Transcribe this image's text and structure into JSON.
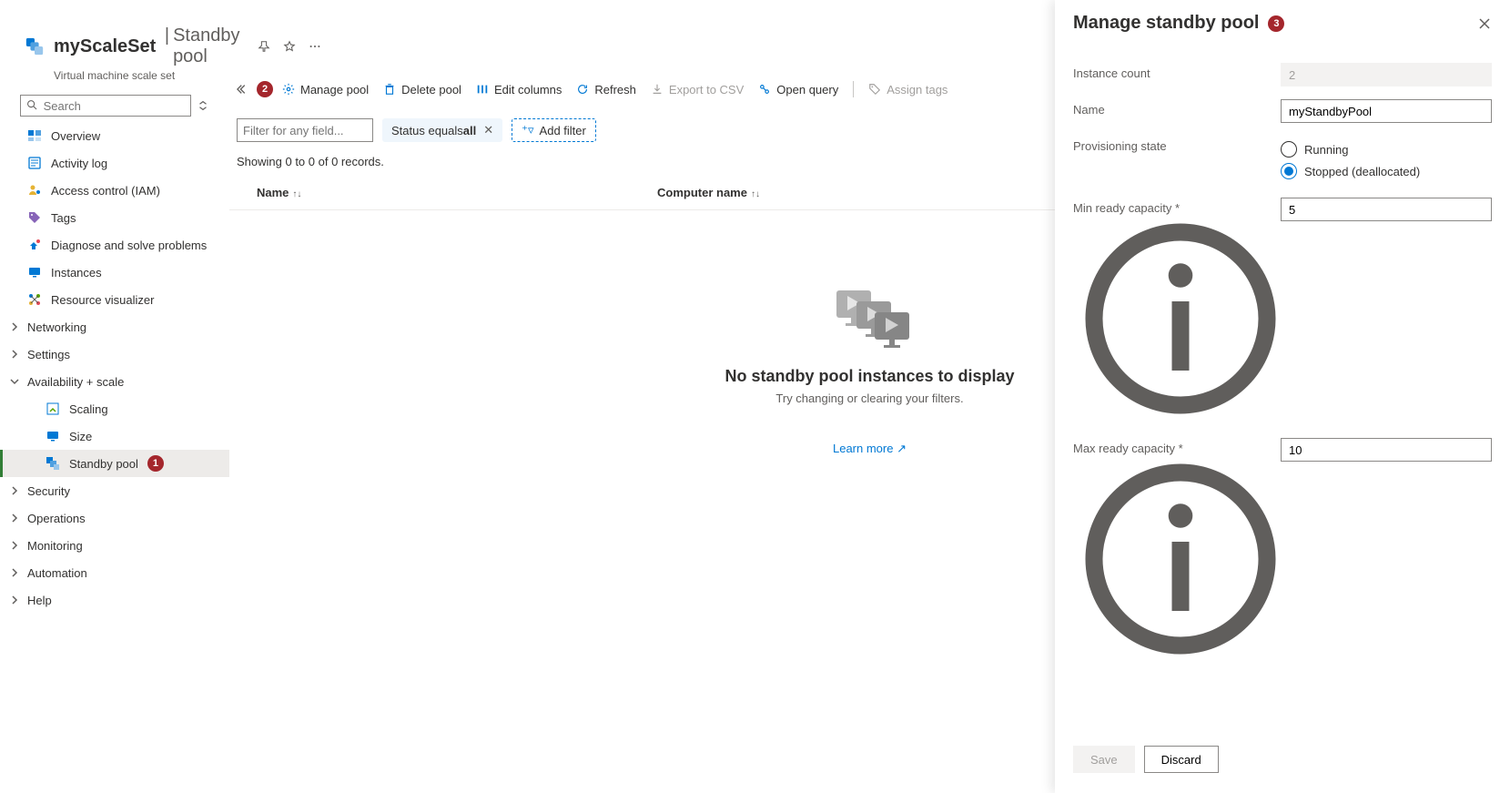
{
  "header": {
    "resourceName": "myScaleSet",
    "separator": "|",
    "pageTitle": "Standby pool",
    "resourceType": "Virtual machine scale set"
  },
  "search": {
    "placeholder": "Search"
  },
  "nav": {
    "items": [
      {
        "label": "Overview"
      },
      {
        "label": "Activity log"
      },
      {
        "label": "Access control (IAM)"
      },
      {
        "label": "Tags"
      },
      {
        "label": "Diagnose and solve problems"
      },
      {
        "label": "Instances"
      },
      {
        "label": "Resource visualizer"
      }
    ],
    "groups": [
      {
        "label": "Networking",
        "expanded": false
      },
      {
        "label": "Settings",
        "expanded": false
      },
      {
        "label": "Availability + scale",
        "expanded": true,
        "children": [
          {
            "label": "Scaling"
          },
          {
            "label": "Size"
          },
          {
            "label": "Standby pool",
            "selected": true
          }
        ]
      },
      {
        "label": "Security",
        "expanded": false
      },
      {
        "label": "Operations",
        "expanded": false
      },
      {
        "label": "Monitoring",
        "expanded": false
      },
      {
        "label": "Automation",
        "expanded": false
      },
      {
        "label": "Help",
        "expanded": false
      }
    ]
  },
  "toolbar": {
    "managePool": "Manage pool",
    "deletePool": "Delete pool",
    "editColumns": "Edit columns",
    "refresh": "Refresh",
    "exportCsv": "Export to CSV",
    "openQuery": "Open query",
    "assignTags": "Assign tags"
  },
  "filters": {
    "placeholder": "Filter for any field...",
    "statusPillPrefix": "Status equals ",
    "statusPillValue": "all",
    "addFilter": "Add filter"
  },
  "records": "Showing 0 to 0 of 0 records.",
  "table": {
    "colName": "Name",
    "colComputer": "Computer name"
  },
  "empty": {
    "title": "No standby pool instances to display",
    "subtitle": "Try changing or clearing your filters.",
    "learnMore": "Learn more"
  },
  "panel": {
    "title": "Manage standby pool",
    "instanceCountLabel": "Instance count",
    "instanceCountValue": "2",
    "nameLabel": "Name",
    "nameValue": "myStandbyPool",
    "provisioningLabel": "Provisioning state",
    "radioRunning": "Running",
    "radioStopped": "Stopped (deallocated)",
    "minReadyLabel": "Min ready capacity *",
    "minReadyValue": "5",
    "maxReadyLabel": "Max ready capacity *",
    "maxReadyValue": "10",
    "save": "Save",
    "discard": "Discard"
  },
  "annotations": {
    "b1": "1",
    "b2": "2",
    "b3": "3"
  }
}
